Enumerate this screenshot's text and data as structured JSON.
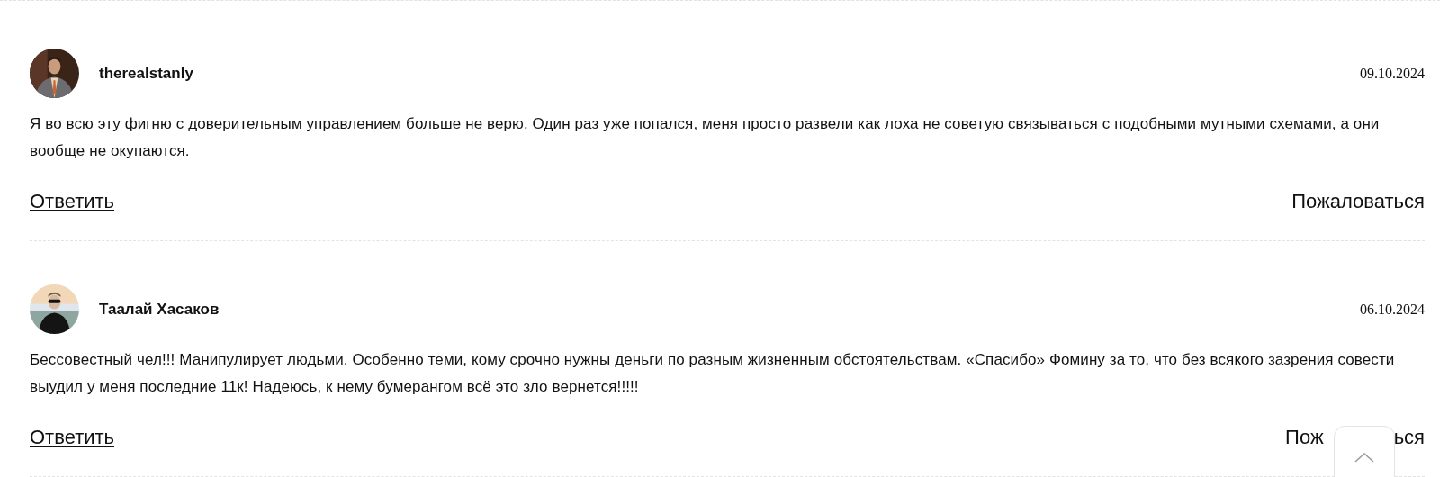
{
  "comments": [
    {
      "author": "therealstanly",
      "date": "09.10.2024",
      "avatar": {
        "kind": "picture"
      },
      "text": "Я во всю эту фигню с доверительным управлением больше не верю. Один раз уже попался, меня просто развели как лоха не советую связываться с подобными мутными схемами, а они вообще не окупаются.",
      "reply": "Ответить",
      "report": [
        "Пожаловаться"
      ]
    },
    {
      "author": "Таалай Хасаков",
      "date": "06.10.2024",
      "avatar": {
        "kind": "picture"
      },
      "text": "Бессовестный чел!!! Манипулирует людьми. Особенно теми, кому срочно нужны деньги по разным жизненным обстоятельствам. «Спасибо» Фомину за то, что без всякого зазрения совести выудил у меня последние 11к! Надеюсь, к нему бумерангом всё это зло вернется!!!!!",
      "reply": "Ответить",
      "report": [
        "Пож",
        "ься"
      ]
    }
  ]
}
